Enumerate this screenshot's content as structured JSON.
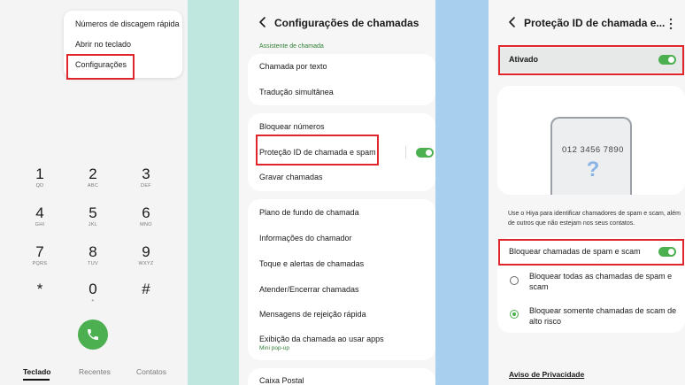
{
  "dialer": {
    "menu": {
      "items": [
        "Números de discagem rápida",
        "Abrir no teclado",
        "Configurações"
      ]
    },
    "keys": [
      {
        "num": "1",
        "letters": "QD"
      },
      {
        "num": "2",
        "letters": "ABC"
      },
      {
        "num": "3",
        "letters": "DEF"
      },
      {
        "num": "4",
        "letters": "GHI"
      },
      {
        "num": "5",
        "letters": "JKL"
      },
      {
        "num": "6",
        "letters": "MNO"
      },
      {
        "num": "7",
        "letters": "PQRS"
      },
      {
        "num": "8",
        "letters": "TUV"
      },
      {
        "num": "9",
        "letters": "WXYZ"
      },
      {
        "num": "*",
        "letters": ""
      },
      {
        "num": "0",
        "letters": "+"
      },
      {
        "num": "#",
        "letters": ""
      }
    ],
    "call_icon": "phone-icon",
    "tabs": [
      "Teclado",
      "Recentes",
      "Contatos"
    ]
  },
  "call_settings": {
    "title": "Configurações de chamadas",
    "section_label": "Assistente de chamada",
    "group1": [
      "Chamada por texto",
      "Tradução simultânea"
    ],
    "group2": [
      "Bloquear números",
      "Proteção ID de chamada e spam",
      "Gravar chamadas"
    ],
    "group3": [
      "Plano de fundo de chamada",
      "Informações do chamador",
      "Toque e alertas de chamadas",
      "Atender/Encerrar chamadas",
      "Mensagens de rejeição rápida",
      "Exibição da chamada ao usar apps"
    ],
    "group3_sub": "Mini pop-up",
    "group4": [
      "Caixa Postal"
    ],
    "spam_toggle_on": true
  },
  "caller_id": {
    "title": "Proteção ID de chamada e...",
    "enabled_label": "Ativado",
    "enabled_on": true,
    "phone_number": "012 3456 7890",
    "phone_question": "?",
    "description": "Use o Hiya para identificar chamadores de spam e scam, além de outros que não estejam nos seus contatos.",
    "block_label": "Bloquear chamadas de spam e scam",
    "block_on": true,
    "options": [
      {
        "label": "Bloquear todas as chamadas de spam e scam",
        "selected": false
      },
      {
        "label": "Bloquear somente chamadas de scam de alto risco",
        "selected": true
      }
    ],
    "privacy_link": "Aviso de Privacidade"
  },
  "colors": {
    "accent_green": "#4caf50",
    "highlight_red": "#e0252b",
    "gap_teal": "#bfe6df",
    "gap_blue": "#a9cfee"
  }
}
